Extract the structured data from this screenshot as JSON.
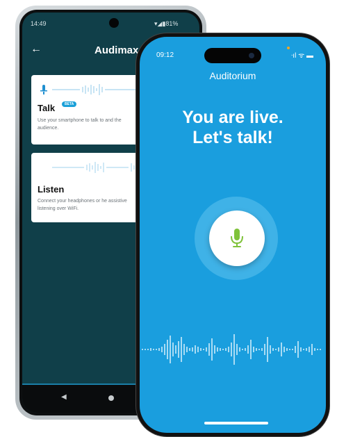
{
  "android": {
    "status_time": "14:49",
    "status_battery": "▾◢▮81%",
    "title": "Audimax",
    "back_icon": "arrow-left-icon",
    "talk_card": {
      "title": "Talk",
      "badge": "BETA",
      "description": "Use your smartphone to talk to and the audience."
    },
    "listen_card": {
      "title": "Listen",
      "description": "Connect your headphones or he assistive listening over WiFi."
    },
    "nav": {
      "back_icon": "◀",
      "home_icon": "home-dot"
    }
  },
  "iphone": {
    "status_time": "09:12",
    "status_icons": "ᐧıl ᯤ ▬",
    "title": "Auditorium",
    "headline_line1": "You are live.",
    "headline_line2": "Let's talk!",
    "mic_icon": "microphone-icon"
  },
  "colors": {
    "android_bg": "#103f49",
    "iphone_bg": "#1a9ede",
    "accent_blue": "#1aa0d8",
    "mic_green": "#7fc23a"
  }
}
